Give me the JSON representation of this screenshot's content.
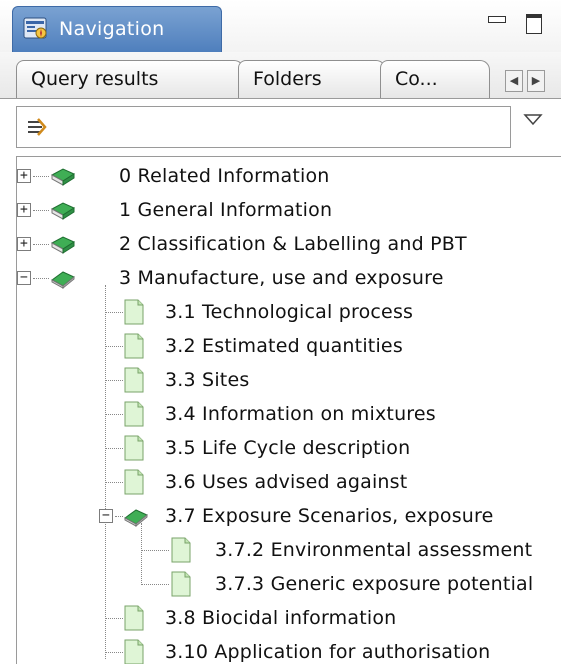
{
  "window": {
    "title": "Navigation",
    "icons": {
      "title": "navigation-panel-icon",
      "minimize": "minimize-icon",
      "maximize": "maximize-icon"
    }
  },
  "tabs": [
    {
      "label": "Query results"
    },
    {
      "label": "Folders"
    },
    {
      "label": "Co..."
    }
  ],
  "tab_scroll": {
    "left": "◀",
    "right": "▶"
  },
  "filter": {
    "value": "",
    "icon": "filter-icon",
    "dropdown_icon": "dropdown-arrow-icon"
  },
  "tree": {
    "nodes": [
      {
        "label": "0 Related Information",
        "level": 0,
        "type": "book",
        "expander": "+"
      },
      {
        "label": "1 General Information",
        "level": 0,
        "type": "book",
        "expander": "+"
      },
      {
        "label": "2 Classification & Labelling and PBT",
        "level": 0,
        "type": "book",
        "expander": "+"
      },
      {
        "label": "3 Manufacture, use and exposure",
        "level": 0,
        "type": "book-open",
        "expander": "−"
      },
      {
        "label": "3.1 Technological process",
        "level": 1,
        "type": "page"
      },
      {
        "label": "3.2 Estimated quantities",
        "level": 1,
        "type": "page"
      },
      {
        "label": "3.3 Sites",
        "level": 1,
        "type": "page"
      },
      {
        "label": "3.4 Information on mixtures",
        "level": 1,
        "type": "page"
      },
      {
        "label": "3.5 Life Cycle description",
        "level": 1,
        "type": "page"
      },
      {
        "label": "3.6 Uses advised against",
        "level": 1,
        "type": "page"
      },
      {
        "label": "3.7 Exposure Scenarios, exposure",
        "level": 1,
        "type": "book-open",
        "expander": "−"
      },
      {
        "label": "3.7.2 Environmental assessment",
        "level": 2,
        "type": "page"
      },
      {
        "label": "3.7.3 Generic exposure potential",
        "level": 2,
        "type": "page"
      },
      {
        "label": "3.8 Biocidal information",
        "level": 1,
        "type": "page"
      },
      {
        "label": "3.10 Application for authorisation",
        "level": 1,
        "type": "page"
      }
    ]
  }
}
